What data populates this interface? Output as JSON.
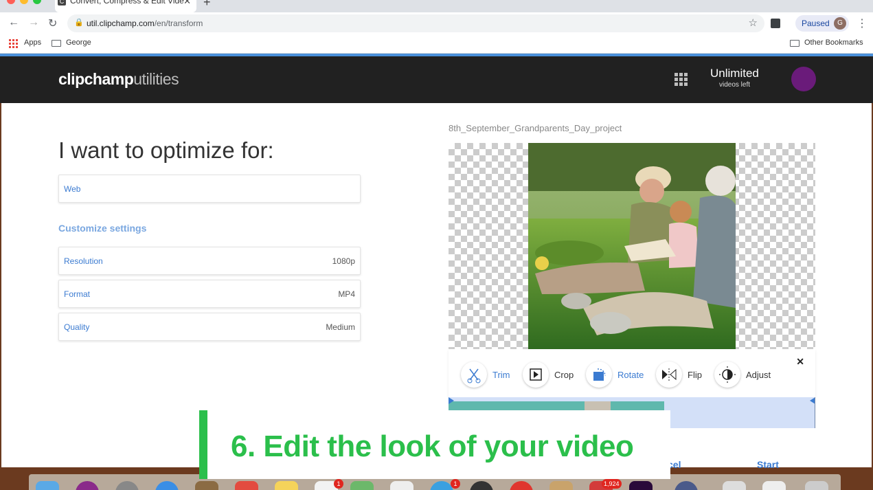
{
  "browser": {
    "tab_title": "Convert, Compress & Edit Vide",
    "tab_favicon_letter": "C",
    "url_host": "util.clipchamp.com",
    "url_path": "/en/transform",
    "profile_status": "Paused",
    "profile_initial": "G",
    "bookmarks": {
      "apps": "Apps",
      "george": "George",
      "other": "Other Bookmarks"
    }
  },
  "app": {
    "logo_bold": "clipchamp",
    "logo_light": "utilities",
    "plan_title": "Unlimited",
    "plan_subtitle": "videos left"
  },
  "form": {
    "heading": "I want to optimize for:",
    "optimize_value": "Web",
    "customize_label": "Customize settings",
    "settings": [
      {
        "label": "Resolution",
        "value": "1080p"
      },
      {
        "label": "Format",
        "value": "MP4"
      },
      {
        "label": "Quality",
        "value": "Medium"
      }
    ]
  },
  "preview": {
    "filename": "8th_September_Grandparents_Day_project",
    "tools": [
      {
        "label": "Trim",
        "icon": "scissors-icon"
      },
      {
        "label": "Crop",
        "icon": "crop-icon"
      },
      {
        "label": "Rotate",
        "icon": "rotate-icon"
      },
      {
        "label": "Flip",
        "icon": "flip-icon"
      },
      {
        "label": "Adjust",
        "icon": "adjust-icon"
      }
    ],
    "active_tool": "Rotate",
    "close": "✕"
  },
  "actions": {
    "cancel": "cel",
    "start": "Start"
  },
  "caption": {
    "text": "6. Edit the look of your video"
  },
  "dock": {
    "badges": [
      "1",
      "1",
      "1,924"
    ]
  },
  "colors": {
    "accent": "#3b7bd1",
    "caption_green": "#2bbf4b",
    "header_dark": "#212121"
  }
}
